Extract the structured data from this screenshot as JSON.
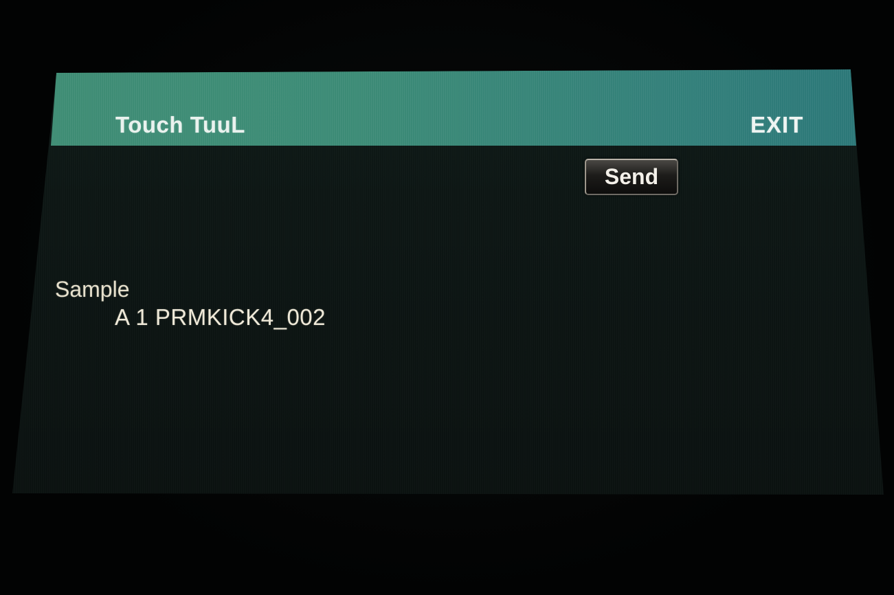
{
  "header": {
    "title": "Touch TuuL",
    "exit_label": "EXIT"
  },
  "toolbar": {
    "send_label": "Send"
  },
  "parameter": {
    "label": "Sample",
    "value": "A 1 PRMKICK4_002"
  },
  "colors": {
    "title_bar": "#3c8b76",
    "screen_background": "#0d1614",
    "text": "#e6e0cc"
  }
}
